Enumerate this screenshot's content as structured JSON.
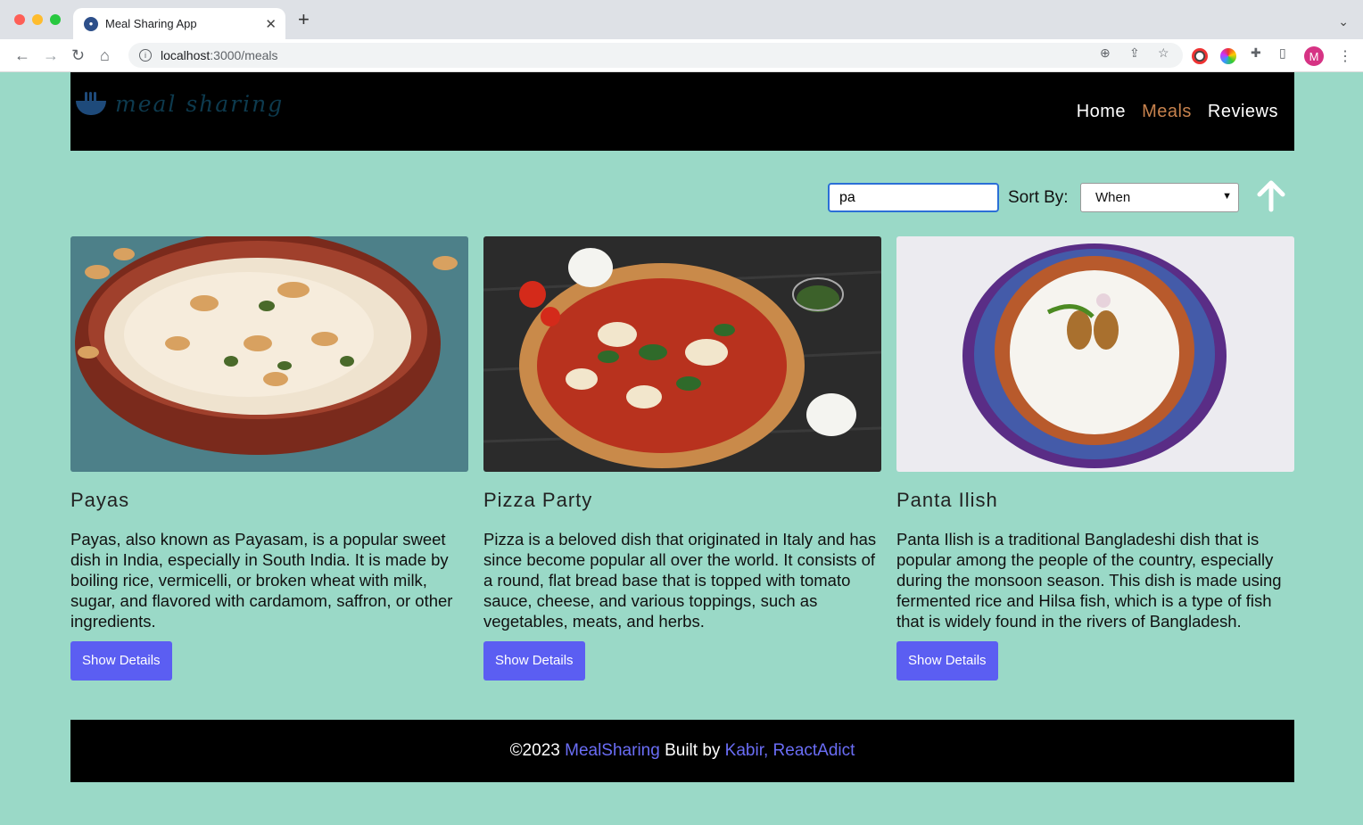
{
  "browser": {
    "tab_title": "Meal Sharing App",
    "url_host": "localhost",
    "url_path": ":3000/meals",
    "profile_initial": "M"
  },
  "header": {
    "logo_text": "meal sharing",
    "nav": [
      {
        "label": "Home",
        "active": false
      },
      {
        "label": "Meals",
        "active": true
      },
      {
        "label": "Reviews",
        "active": false
      }
    ]
  },
  "controls": {
    "search_value": "pa",
    "sort_label": "Sort By:",
    "sort_value": "When"
  },
  "meals": [
    {
      "title": "Payas",
      "description": "Payas, also known as Payasam, is a popular sweet dish in India, especially in South India. It is made by boiling rice, vermicelli, or broken wheat with milk, sugar, and flavored with cardamom, saffron, or other ingredients.",
      "button": "Show Details"
    },
    {
      "title": "Pizza Party",
      "description": "Pizza is a beloved dish that originated in Italy and has since become popular all over the world. It consists of a round, flat bread base that is topped with tomato sauce, cheese, and various toppings, such as vegetables, meats, and herbs.",
      "button": "Show Details"
    },
    {
      "title": "Panta Ilish",
      "description": "Panta Ilish is a traditional Bangladeshi dish that is popular among the people of the country, especially during the monsoon season. This dish is made using fermented rice and Hilsa fish, which is a type of fish that is widely found in the rivers of Bangladesh.",
      "button": "Show Details"
    }
  ],
  "footer": {
    "copyright": "©2023",
    "brand": "MealSharing",
    "built_by": "Built by",
    "author": "Kabir, ReactAdict"
  },
  "colors": {
    "page_bg": "#9ad9c7",
    "accent": "#5b5ef2",
    "nav_active": "#c7824d"
  }
}
